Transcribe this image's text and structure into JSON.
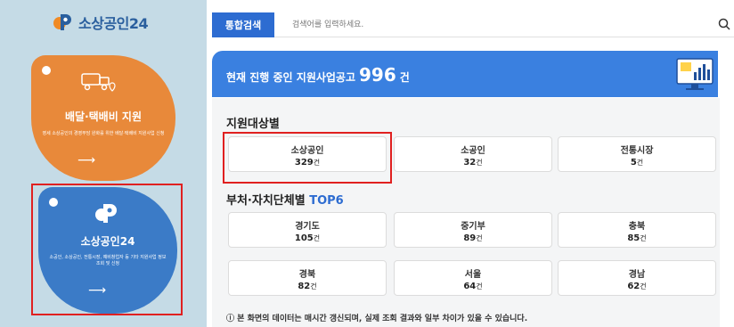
{
  "sidebar": {
    "logo_text": "소상공인24",
    "cards": [
      {
        "title": "배달·택배비 지원",
        "desc": "영세 소상공인의 경영부담 완화를 위한 배달·택배비 지원사업 신청",
        "color": "#e8893a"
      },
      {
        "title": "소상공인24",
        "desc": "소공인, 소상공인, 전통시장, 예비창업자 등 기타 지원사업 정보 조회 및 신청",
        "color": "#3b7bc7"
      }
    ]
  },
  "search": {
    "tab_label": "통합검색",
    "placeholder": "검색어를 입력하세요."
  },
  "banner": {
    "text": "현재 진행 중인 지원사업공고",
    "count": "996",
    "unit": "건"
  },
  "target_section": {
    "title": "지원대상별",
    "tiles": [
      {
        "name": "소상공인",
        "count": "329",
        "unit": "건"
      },
      {
        "name": "소공인",
        "count": "32",
        "unit": "건"
      },
      {
        "name": "전통시장",
        "count": "5",
        "unit": "건"
      }
    ]
  },
  "ministry_section": {
    "title": "부처·자치단체별",
    "title_accent": "TOP6",
    "tiles": [
      {
        "name": "경기도",
        "count": "105",
        "unit": "건"
      },
      {
        "name": "중기부",
        "count": "89",
        "unit": "건"
      },
      {
        "name": "충북",
        "count": "85",
        "unit": "건"
      },
      {
        "name": "경북",
        "count": "82",
        "unit": "건"
      },
      {
        "name": "서울",
        "count": "64",
        "unit": "건"
      },
      {
        "name": "경남",
        "count": "62",
        "unit": "건"
      }
    ]
  },
  "footnote": "본 화면의 데이터는 매시간 갱신되며, 실제 조회 결과와 일부 차이가 있을 수 있습니다.",
  "colors": {
    "accent": "#2d6cd1",
    "highlight": "#e02020",
    "sidebar_bg": "#c5dbe6"
  }
}
